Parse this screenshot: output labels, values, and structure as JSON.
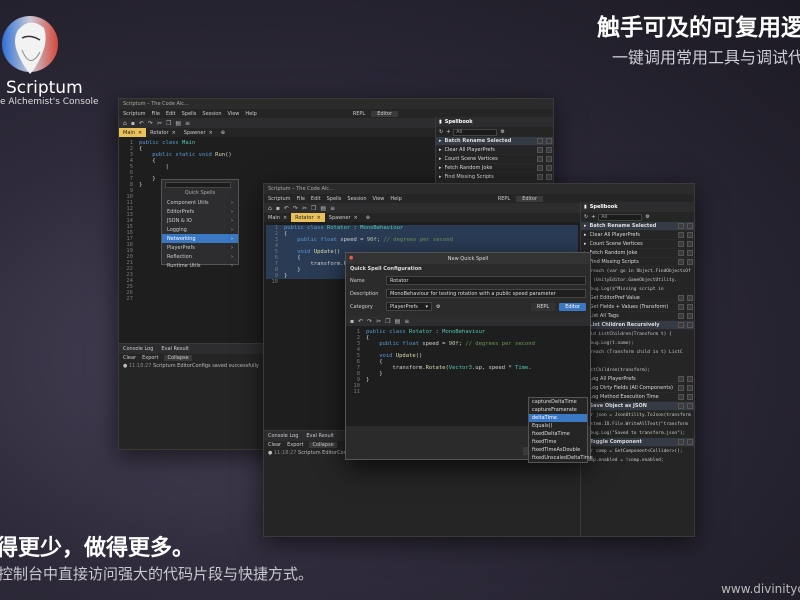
{
  "brand": {
    "name": "Scriptum",
    "tagline": "e Alchemist's Console"
  },
  "hero": {
    "title": "触手可及的可复用逻",
    "subtitle": "一键调用常用工具与调试代"
  },
  "footer": {
    "title": "得更少，做得更多。",
    "subtitle": "控制台中直接访问强大的代码片段与快捷方式。",
    "url": "www.divinityc"
  },
  "window_back": {
    "title": "Scriptum – The Code Alc...",
    "menu": [
      "Scriptum",
      "File",
      "Edit",
      "Spells",
      "Session",
      "View",
      "Help"
    ],
    "mode_tabs": [
      "REPL",
      "Editor"
    ],
    "tabs": [
      "Main",
      "Rotator",
      "Spawner"
    ],
    "code": [
      "public class Main",
      "{",
      "    public static void Run()",
      "    {",
      "",
      "    }",
      "}"
    ],
    "console": {
      "tabs": [
        "Console Log",
        "Eval Result"
      ],
      "buttons": [
        "Clear",
        "Export",
        "Collapse"
      ],
      "message_time": "11:18:27",
      "message": "Scriptum EditorConfigs saved successfully"
    },
    "quick_spells": {
      "title": "Quick Spells",
      "items": [
        "Component Utils",
        "EditorPrefs",
        "JSON & IO",
        "Logging",
        "Networking",
        "PlayerPrefs",
        "Reflection",
        "Runtime Utils"
      ],
      "selected": "Networking"
    },
    "spellbook": {
      "title": "Spellbook",
      "filter": "All",
      "items": [
        "Batch Rename Selected",
        "Clear All PlayerPrefs",
        "Count Scene Vertices",
        "Fetch Random Joke",
        "Find Missing Scripts"
      ]
    }
  },
  "window_front": {
    "title": "Scriptum – The Code Alc...",
    "menu": [
      "Scriptum",
      "File",
      "Edit",
      "Spells",
      "Session",
      "View",
      "Help"
    ],
    "mode_tabs": [
      "REPL",
      "Editor"
    ],
    "tabs": [
      "Main",
      "Rotator",
      "Spawner"
    ],
    "code": [
      "public class Rotator : MonoBehaviour",
      "{",
      "    public float speed = 90f; // degrees per second",
      "",
      "    void Update()",
      "    {",
      "        transform.Ro",
      "    }",
      "}"
    ],
    "console": {
      "tabs": [
        "Console Log",
        "Eval Result"
      ],
      "buttons": [
        "Clear",
        "Export",
        "Collapse"
      ],
      "message_time": "11:18:27",
      "message": "Scriptum EditorConfigs"
    },
    "spellbook": {
      "title": "Spellbook",
      "filter": "All",
      "items": [
        {
          "label": "Batch Rename Selected",
          "kind": "spell",
          "hl": true
        },
        {
          "label": "Clear All PlayerPrefs",
          "kind": "spell"
        },
        {
          "label": "Count Scene Vertices",
          "kind": "spell"
        },
        {
          "label": "Fetch Random Joke",
          "kind": "spell"
        },
        {
          "label": "Find Missing Scripts",
          "kind": "spell"
        },
        {
          "label": "foreach (var go in Object.FindObjectsOf",
          "kind": "code"
        },
        {
          "label": "    if (UnityEditor.GameObjectUtility.",
          "kind": "code"
        },
        {
          "label": "        Debug.Log($\"Missing script in",
          "kind": "code"
        },
        {
          "label": "Get EditorPref Value",
          "kind": "spell"
        },
        {
          "label": "Get Fields + Values (Transform)",
          "kind": "spell"
        },
        {
          "label": "List All Tags",
          "kind": "spell"
        },
        {
          "label": "List Children Recursively",
          "kind": "spell",
          "hl": true
        },
        {
          "label": "void ListChildren(Transform t) {",
          "kind": "code"
        },
        {
          "label": "    Debug.Log(t.name);",
          "kind": "code"
        },
        {
          "label": "    foreach (Transform child in t) ListC",
          "kind": "code"
        },
        {
          "label": "}",
          "kind": "code"
        },
        {
          "label": "ListChildren(transform);",
          "kind": "code"
        },
        {
          "label": "Log All PlayerPrefs",
          "kind": "spell"
        },
        {
          "label": "Log Dirty Fields (All Components)",
          "kind": "spell"
        },
        {
          "label": "Log Method Execution Time",
          "kind": "spell"
        },
        {
          "label": "Save Object as JSON",
          "kind": "spell",
          "hl": true
        },
        {
          "label": "var json = JsonUtility.ToJson(transform",
          "kind": "code"
        },
        {
          "label": "System.IO.File.WriteAllText(\"transform",
          "kind": "code"
        },
        {
          "label": "Debug.Log(\"Saved to transform.json\");",
          "kind": "code"
        },
        {
          "label": "Toggle Component",
          "kind": "spell",
          "hl": true
        },
        {
          "label": "var comp = GetComponent<Collider>();",
          "kind": "code"
        },
        {
          "label": "comp.enabled = !comp.enabled;",
          "kind": "code"
        }
      ]
    }
  },
  "dialog": {
    "title": "New Quick Spell",
    "section": "Quick Spell Configuration",
    "name_label": "Name",
    "name_value": "Rotator",
    "desc_label": "Description",
    "desc_value": "MonoBehaviour for testing rotation with a public speed parameter",
    "category_label": "Category",
    "category_value": "PlayerPrefs",
    "mode_repl": "REPL",
    "mode_editor": "Editor",
    "code": [
      "public class Rotator : MonoBehaviour",
      "{",
      "    public float speed = 90f; // degrees per second",
      "",
      "    void Update()",
      "    {",
      "        transform.Rotate(Vector3.up, speed * Time.",
      "    }",
      "}",
      "",
      ""
    ],
    "autocomplete": [
      "captureDeltaTime",
      "captureFramerate",
      "deltaTime",
      "Equals()",
      "fixedDeltaTime",
      "fixedTime",
      "fixedTimeAsDouble",
      "fixedUnscaledDeltaTime"
    ],
    "autocomplete_selected": "deltaTime",
    "cancel_label": "Ca"
  }
}
